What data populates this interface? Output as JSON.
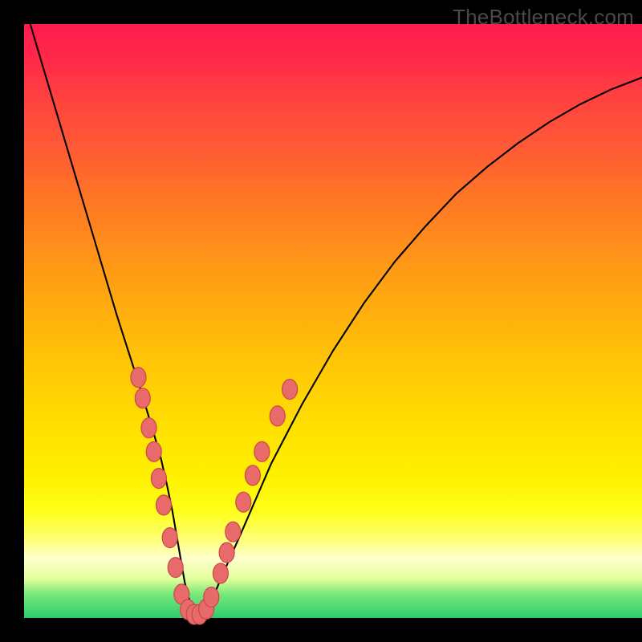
{
  "watermark": "TheBottleneck.com",
  "colors": {
    "gradient_top": "#ff1a4d",
    "gradient_mid": "#ffe000",
    "gradient_bottom": "#2ecc71",
    "curve": "#000000",
    "bead_fill": "#e96a6a",
    "bead_stroke": "#c94848",
    "frame": "#000000",
    "watermark_text": "#4a4a4a"
  },
  "chart_data": {
    "type": "line",
    "title": "",
    "xlabel": "",
    "ylabel": "",
    "xlim": [
      0,
      100
    ],
    "ylim": [
      0,
      100
    ],
    "annotations": [
      "TheBottleneck.com"
    ],
    "series": [
      {
        "name": "bottleneck-curve",
        "x": [
          1,
          3,
          5,
          7,
          9,
          11,
          13,
          15,
          17,
          19,
          21,
          22,
          23,
          24,
          25,
          26,
          27,
          28,
          29,
          30,
          32,
          35,
          40,
          45,
          50,
          55,
          60,
          65,
          70,
          75,
          80,
          85,
          90,
          95,
          100
        ],
        "y": [
          100,
          93,
          86,
          79,
          72,
          65,
          58,
          51,
          44.5,
          38,
          31,
          27.5,
          23,
          18,
          12,
          6,
          2,
          0.5,
          0.5,
          2,
          7,
          14,
          26,
          36,
          45,
          53,
          60,
          66,
          71.5,
          76,
          80,
          83.5,
          86.5,
          89,
          91
        ]
      }
    ],
    "markers": {
      "name": "curve-beads",
      "points": [
        {
          "x": 18.5,
          "y": 40.5
        },
        {
          "x": 19.2,
          "y": 37
        },
        {
          "x": 20.2,
          "y": 32
        },
        {
          "x": 21.0,
          "y": 28
        },
        {
          "x": 21.8,
          "y": 23.5
        },
        {
          "x": 22.6,
          "y": 19
        },
        {
          "x": 23.6,
          "y": 13.5
        },
        {
          "x": 24.5,
          "y": 8.5
        },
        {
          "x": 25.5,
          "y": 4
        },
        {
          "x": 26.5,
          "y": 1.4
        },
        {
          "x": 27.5,
          "y": 0.6
        },
        {
          "x": 28.4,
          "y": 0.6
        },
        {
          "x": 29.5,
          "y": 1.5
        },
        {
          "x": 30.3,
          "y": 3.5
        },
        {
          "x": 31.8,
          "y": 7.5
        },
        {
          "x": 32.8,
          "y": 11
        },
        {
          "x": 33.8,
          "y": 14.5
        },
        {
          "x": 35.5,
          "y": 19.5
        },
        {
          "x": 37.0,
          "y": 24
        },
        {
          "x": 38.5,
          "y": 28
        },
        {
          "x": 41.0,
          "y": 34
        },
        {
          "x": 43.0,
          "y": 38.5
        }
      ]
    }
  }
}
